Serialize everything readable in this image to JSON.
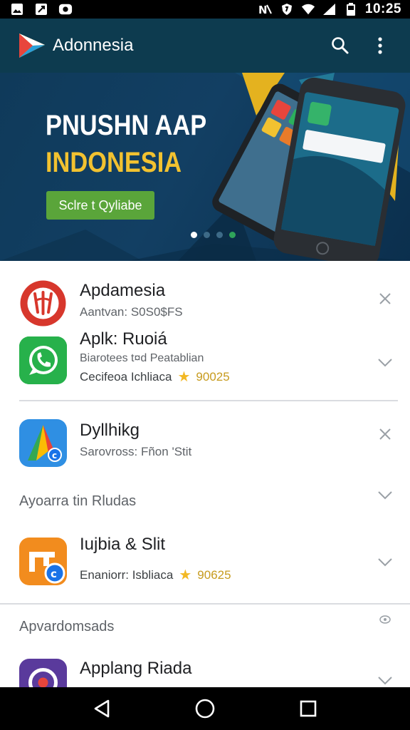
{
  "status_bar": {
    "time": "10:25",
    "left_icons": [
      "gallery-icon",
      "navigation-icon",
      "messenger-icon"
    ],
    "right_icons": [
      "nfc-icon",
      "shield-icon",
      "wifi-icon",
      "signal-icon",
      "battery-icon"
    ]
  },
  "app_bar": {
    "title": "Adonnesia",
    "icons": [
      "search-icon",
      "overflow-menu-icon"
    ]
  },
  "hero": {
    "title": "PNUSHN AAP",
    "subtitle": "INDONESIA",
    "cta_label": "Sclre t Qyliabe",
    "carousel_count": 4,
    "carousel_active": 1
  },
  "items": [
    {
      "name": "Apdamesia",
      "line1": "Aantvan: S0S0$FS",
      "trailing": "close"
    },
    {
      "name": "Aplk: Ruoiá",
      "line1": "Biarotees t¤d Peatablian",
      "meta": "Cecifeoa Ichliaca",
      "rating": "90025",
      "trailing": "chevron"
    },
    {
      "name": "Dyllhikg",
      "line1": "Sarovross: Fñon 'Stit",
      "trailing": "close"
    },
    {
      "name": "Iujbia & Slit",
      "meta": "Enaniorr: Isbliaca",
      "rating": "90625",
      "trailing": "chevron"
    },
    {
      "name": "Applang Riada",
      "trailing": "chevron"
    }
  ],
  "sections": [
    {
      "title": "Ayoarra tin Rludas"
    },
    {
      "title": "Apvardomsads"
    }
  ],
  "nav_bar": {
    "icons": [
      "back-icon",
      "home-icon",
      "recents-icon"
    ]
  },
  "colors": {
    "app_bar": "#0d3b4f",
    "hero_bg": "#0f3a5a",
    "hero_accent": "#f2c230",
    "cta_green": "#5aa53a",
    "star": "#f2b824"
  }
}
